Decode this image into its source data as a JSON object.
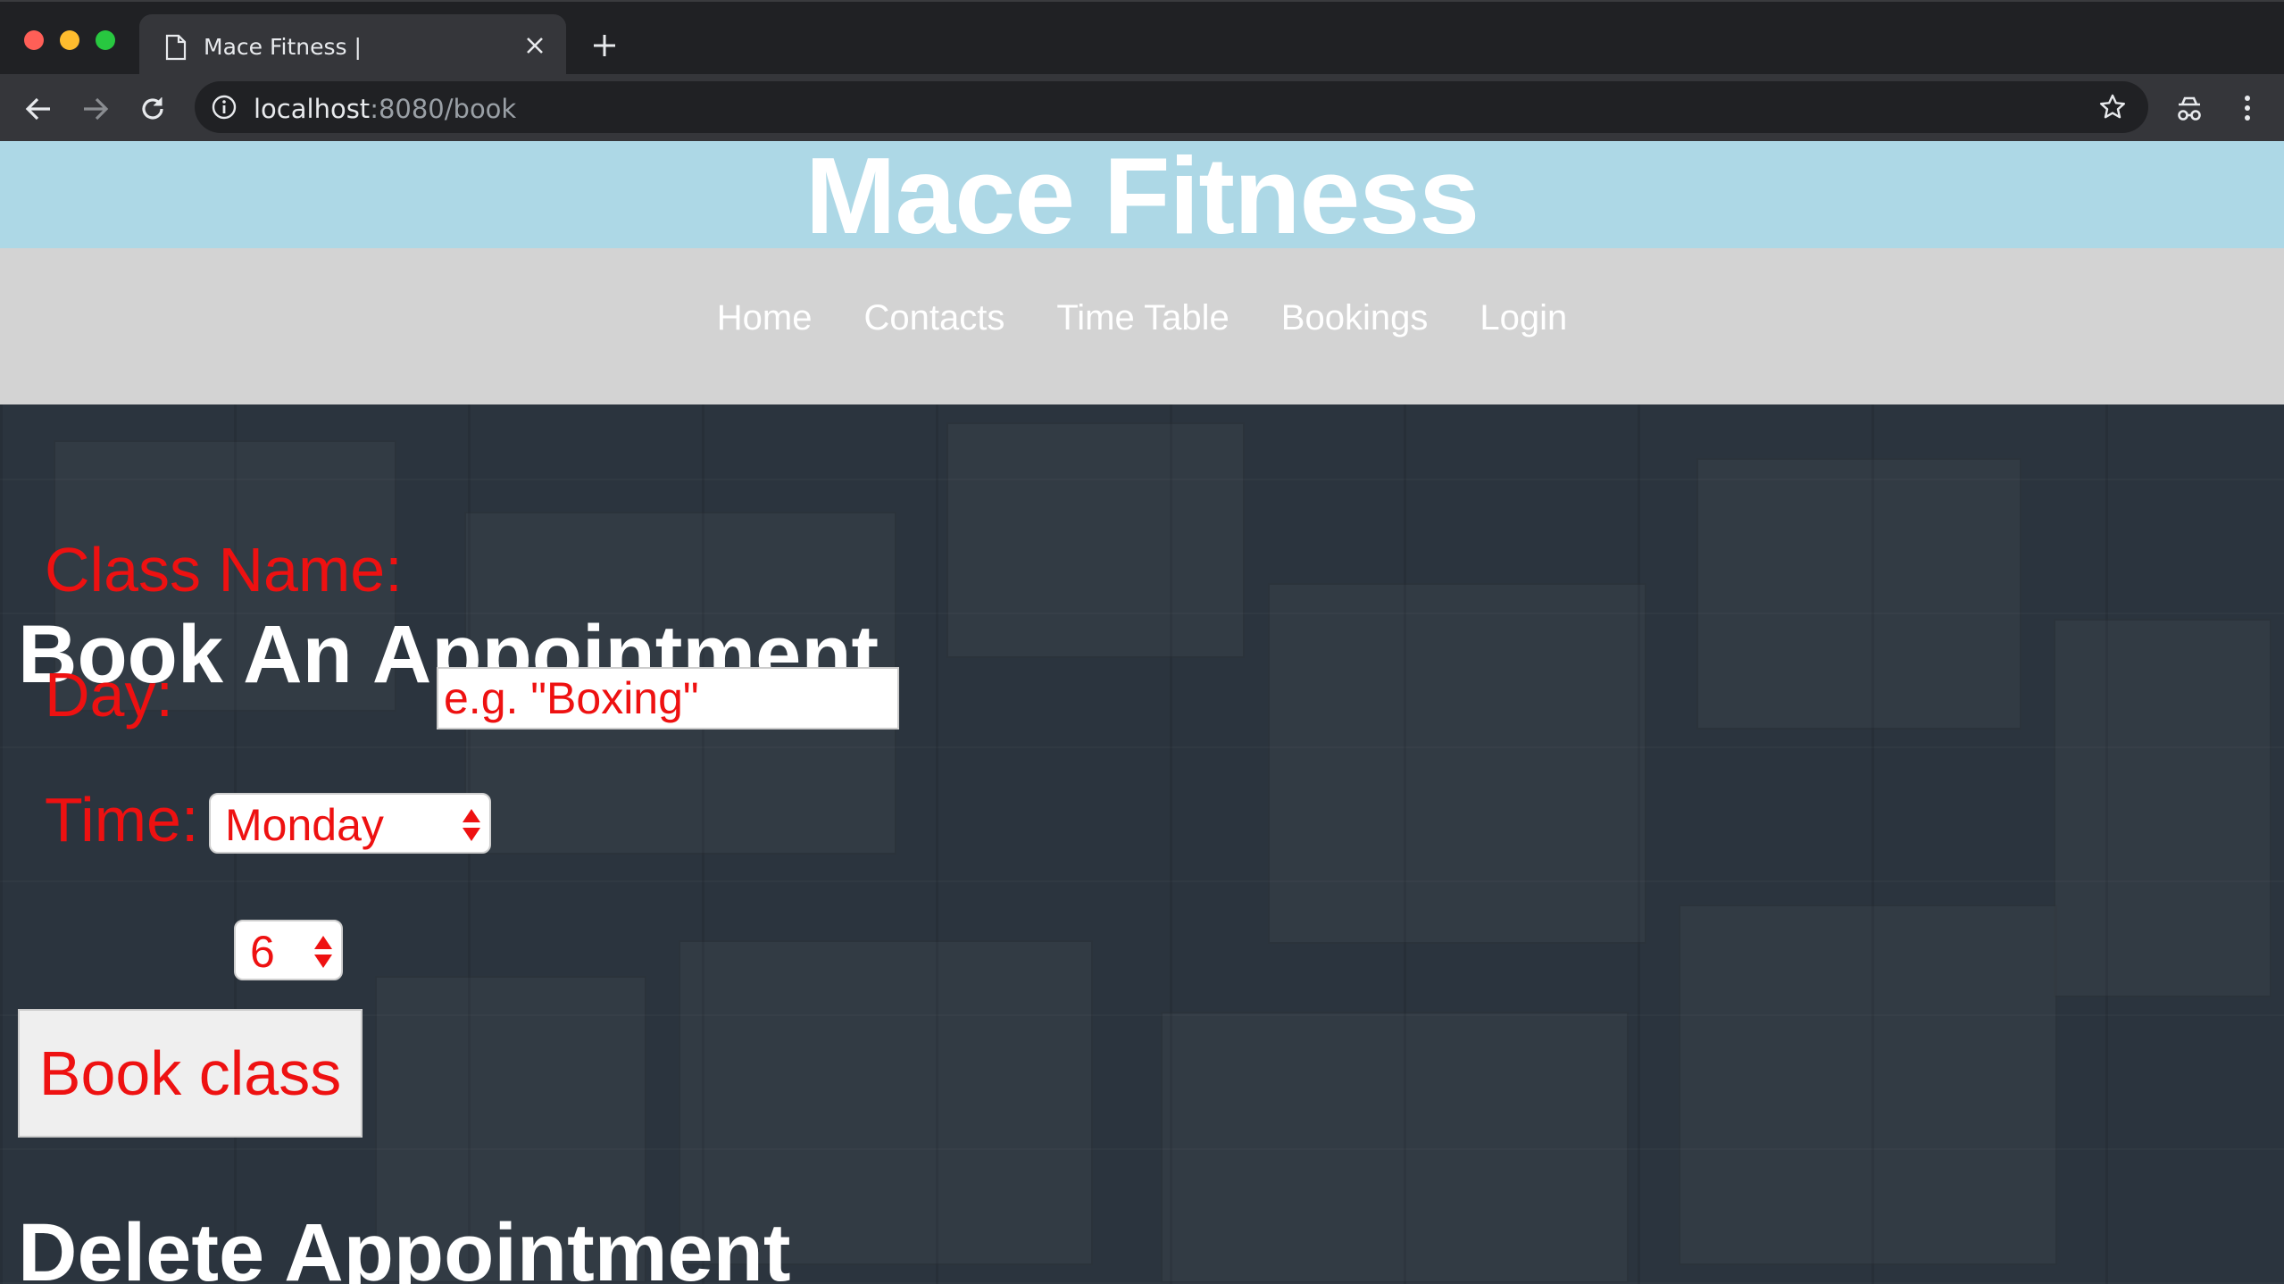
{
  "browser": {
    "tab_title": "Mace Fitness |",
    "url_host": "localhost",
    "url_rest": ":8080/book"
  },
  "header": {
    "title": "Mace Fitness"
  },
  "nav": {
    "items": [
      "Home",
      "Contacts",
      "Time Table",
      "Bookings",
      "Login"
    ]
  },
  "book_section": {
    "heading": "Book An Appointment",
    "class_label": "Class Name:",
    "class_placeholder": "e.g. \"Boxing\"",
    "day_label": "Day:",
    "day_value": "Monday",
    "time_label": "Time:",
    "time_value": "6",
    "submit_label": "Book class"
  },
  "delete_section": {
    "heading": "Delete Appointment"
  },
  "colors": {
    "header_bg": "#add8e6",
    "nav_bg": "#d3d3d3",
    "form_text": "#ee1111"
  }
}
